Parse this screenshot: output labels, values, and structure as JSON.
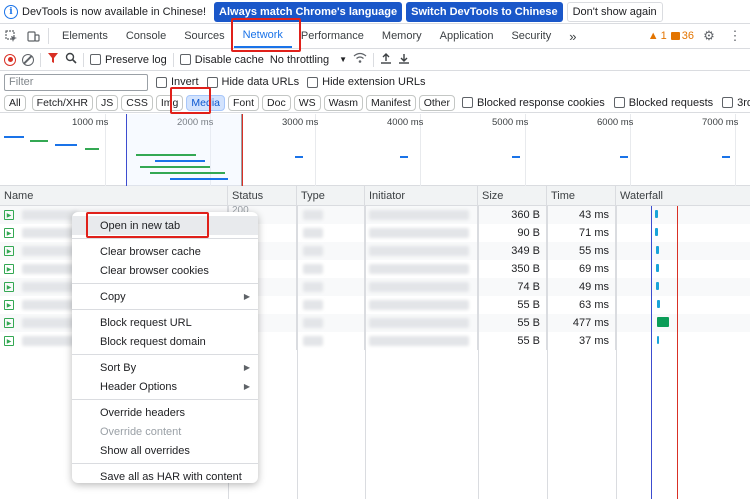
{
  "banner": {
    "text": "DevTools is now available in Chinese!",
    "btn_match": "Always match Chrome's language",
    "btn_switch": "Switch DevTools to Chinese",
    "btn_dismiss": "Don't show again"
  },
  "tabs": [
    "Elements",
    "Console",
    "Sources",
    "Network",
    "Performance",
    "Memory",
    "Application",
    "Security"
  ],
  "badges": {
    "warnings": "1",
    "messages": "36"
  },
  "toolbar": {
    "preserve_log": "Preserve log",
    "disable_cache": "Disable cache",
    "throttling": "No throttling"
  },
  "filter": {
    "placeholder": "Filter",
    "invert": "Invert",
    "hide_data_urls": "Hide data URLs",
    "hide_extension_urls": "Hide extension URLs"
  },
  "types": [
    "All",
    "Fetch/XHR",
    "JS",
    "CSS",
    "Img",
    "Media",
    "Font",
    "Doc",
    "WS",
    "Wasm",
    "Manifest",
    "Other"
  ],
  "type_checks": {
    "blocked_cookies": "Blocked response cookies",
    "blocked_requests": "Blocked requests",
    "third_party": "3rd-party r"
  },
  "overview_ticks": [
    "1000 ms",
    "2000 ms",
    "3000 ms",
    "4000 ms",
    "5000 ms",
    "6000 ms",
    "7000 ms"
  ],
  "columns": {
    "name": "Name",
    "status": "Status",
    "type": "Type",
    "initiator": "Initiator",
    "size": "Size",
    "time": "Time",
    "waterfall": "Waterfall"
  },
  "rows": [
    {
      "size": "360 B",
      "time": "43 ms"
    },
    {
      "size": "90 B",
      "time": "71 ms"
    },
    {
      "size": "349 B",
      "time": "55 ms"
    },
    {
      "size": "350 B",
      "time": "69 ms"
    },
    {
      "size": "74 B",
      "time": "49 ms"
    },
    {
      "size": "55 B",
      "time": "63 ms"
    },
    {
      "size": "55 B",
      "time": "477 ms"
    },
    {
      "size": "55 B",
      "time": "37 ms"
    }
  ],
  "status_fragment": "200",
  "menu": {
    "open_new_tab": "Open in new tab",
    "clear_cache": "Clear browser cache",
    "clear_cookies": "Clear browser cookies",
    "copy": "Copy",
    "block_url": "Block request URL",
    "block_domain": "Block request domain",
    "sort_by": "Sort By",
    "header_options": "Header Options",
    "override_headers": "Override headers",
    "override_content": "Override content",
    "show_overrides": "Show all overrides",
    "save_har": "Save all as HAR with content"
  },
  "colors": {
    "accent": "#1a73e8",
    "annotation_red": "#e0201a",
    "media_active": "#d3e3fd"
  }
}
